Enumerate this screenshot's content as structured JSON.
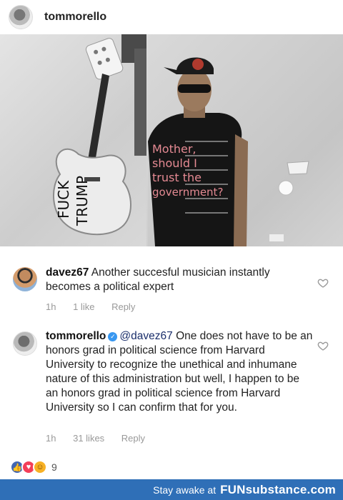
{
  "post": {
    "username": "tommorello"
  },
  "photo": {
    "shirt_lines": [
      "Mother,",
      "should I",
      "trust the",
      "government?"
    ],
    "guitar_lines": [
      "FUCK",
      "TRUMP"
    ]
  },
  "comments": [
    {
      "username": "davez67",
      "text": "Another succesful musician instantly becomes a political expert",
      "time": "1h",
      "likes": "1 like",
      "reply": "Reply"
    },
    {
      "username": "tommorello",
      "mention": "@davez67",
      "text": "One does not have to be an honors grad in political science from Harvard University to recognize the unethical and inhumane nature of this administration but well, I happen to be an honors grad in political science from Harvard University so I can confirm that for you.",
      "time": "1h",
      "likes": "31 likes",
      "reply": "Reply"
    }
  ],
  "reactions": {
    "count": "9",
    "icons": [
      "like-icon",
      "love-icon",
      "haha-icon"
    ]
  },
  "footer": {
    "tagline": "Stay awake at",
    "brand": "FUNsubstance.com"
  },
  "colors": {
    "footer_bg": "#2f6fb7",
    "verified": "#3897f0",
    "mention": "#1a2e6b"
  }
}
